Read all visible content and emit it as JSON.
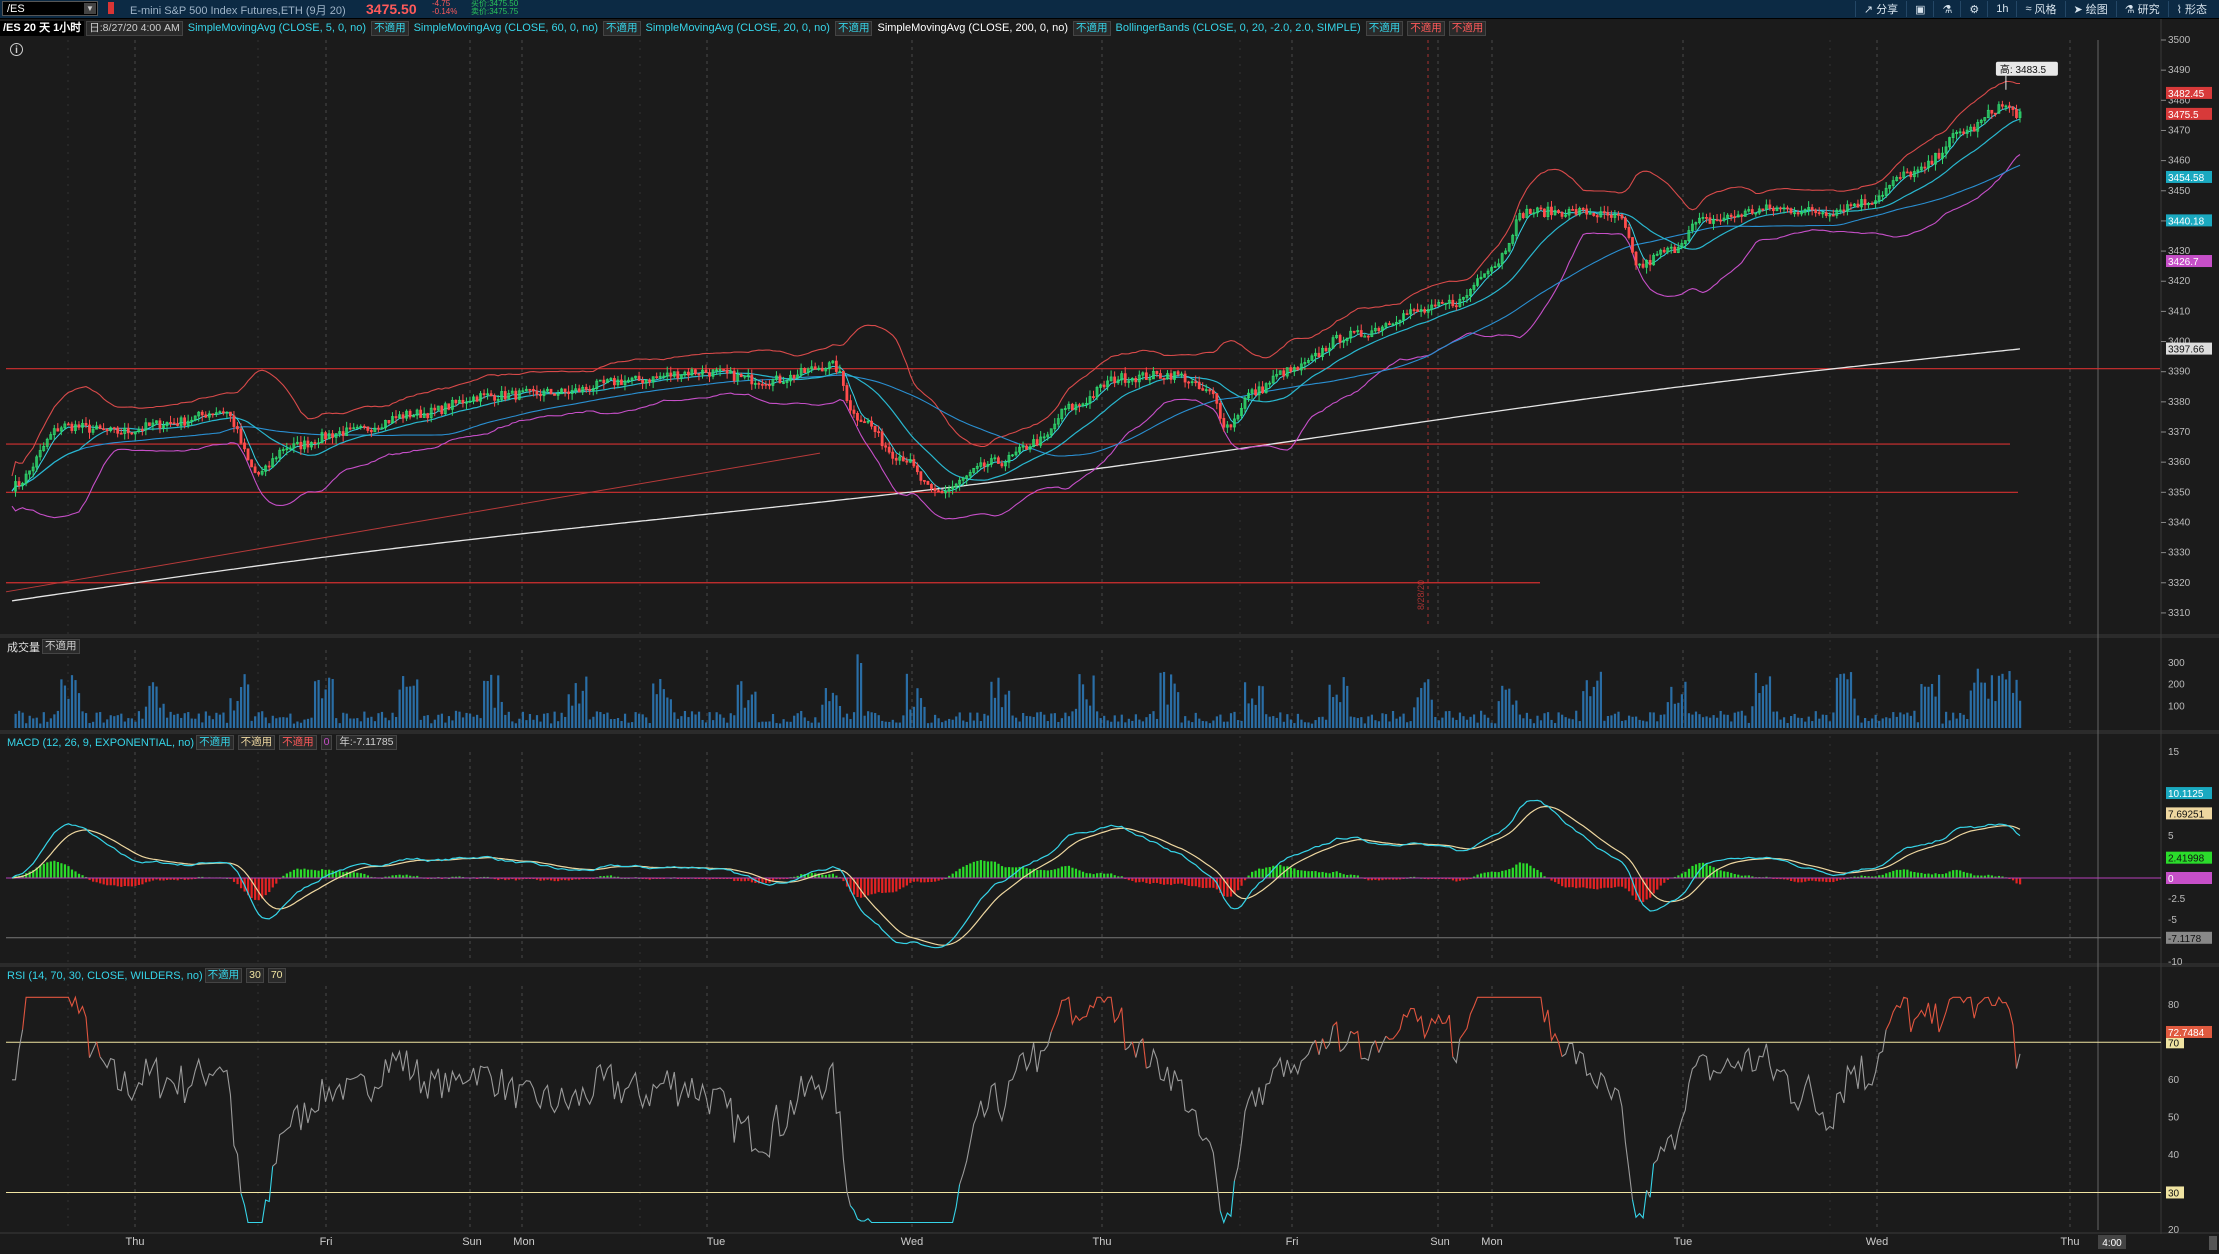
{
  "header": {
    "symbol": "/ES",
    "description": "E-mini S&P 500 Index Futures,ETH (9月 20)",
    "last_price": "3475.50",
    "change_lines": [
      "-4.75",
      "-0.14%"
    ],
    "bid_ask_lines": [
      "买价:3475.50",
      "卖价:3475.75"
    ],
    "toolbar": [
      {
        "label": "分享",
        "icon": "share-icon"
      },
      {
        "label": "",
        "icon": "layout-icon"
      },
      {
        "label": "",
        "icon": "flask-icon"
      },
      {
        "label": "",
        "icon": "gear-icon"
      },
      {
        "label": "1h",
        "icon": ""
      },
      {
        "label": "风格",
        "icon": "style-icon"
      },
      {
        "label": "绘图",
        "icon": "cursor-icon"
      },
      {
        "label": "研究",
        "icon": "flask-icon"
      },
      {
        "label": "形态",
        "icon": "pattern-icon"
      }
    ]
  },
  "study_bar": {
    "period": "/ES 20 天 1小时",
    "date": "日:8/27/20 4:00 AM",
    "studies": [
      {
        "text": "SimpleMovingAvg (CLOSE, 5, 0, no)",
        "color": "#36d4e8",
        "na": [
          "不適用"
        ]
      },
      {
        "text": "SimpleMovingAvg (CLOSE, 60, 0, no)",
        "color": "#36d4e8",
        "na": [
          "不適用"
        ]
      },
      {
        "text": "SimpleMovingAvg (CLOSE, 20, 0, no)",
        "color": "#36d4e8",
        "na": [
          "不適用"
        ]
      },
      {
        "text": "SimpleMovingAvg (CLOSE, 200, 0, no)",
        "color": "#ffffff",
        "na": [
          "不適用"
        ]
      },
      {
        "text": "BollingerBands (CLOSE, 0, 20, -2.0, 2.0, SIMPLE)",
        "color": "#36d4e8",
        "na": [
          "不適用",
          "不適用",
          "不適用"
        ]
      }
    ]
  },
  "volume_panel": {
    "label": "成交量",
    "na": "不適用"
  },
  "macd_panel": {
    "label": "MACD (12, 26, 9, EXPONENTIAL, no)",
    "na": [
      "不適用",
      "不適用",
      "不適用"
    ],
    "zero": "0",
    "extra": "年:-7.11785"
  },
  "rsi_panel": {
    "label": "RSI (14, 70, 30, CLOSE, WILDERS, no)",
    "na": "不適用",
    "levels": [
      "30",
      "70"
    ]
  },
  "price_tags": {
    "high_callout": "高: 3483.5",
    "last": "3475.5",
    "bb_upper": "3482.45",
    "sma5": "3454.58",
    "sma20": "3440.18",
    "bb_lower": "3426.7",
    "sma200": "3397.66"
  },
  "macd_tags": {
    "value": "10.1125",
    "avg": "7.69251",
    "diff": "2.41998",
    "zero": "0",
    "low_line": "-7.1178"
  },
  "rsi_tag": "72.7484",
  "rsi_level_tags": [
    "70",
    "30"
  ],
  "time_axis": {
    "days": [
      {
        "label": "Thu"
      },
      {
        "label": "Fri"
      },
      {
        "label": "Sun"
      },
      {
        "label": "Mon"
      },
      {
        "label": "Tue"
      },
      {
        "label": "Wed"
      },
      {
        "label": "Thu"
      },
      {
        "label": "Fri"
      },
      {
        "label": "Sun"
      },
      {
        "label": "Mon"
      },
      {
        "label": "Tue"
      },
      {
        "label": "Wed"
      },
      {
        "label": "Thu"
      }
    ],
    "current_time_badge": "4:00"
  },
  "vertical_marker_text": "8/28/20",
  "colors": {
    "background": "#1b1b1b",
    "up_candle": "#2fd86e",
    "down_candle": "#ff4d4d",
    "sma5": "#36d4e8",
    "sma20": "#29b7cf",
    "sma200": "#e6e6e6",
    "bb_upper": "#d84a4a",
    "bb_lower": "#c64fc8",
    "hline": "#d43030",
    "volume": "#2a6ea6",
    "macd_line": "#36d4e8",
    "macd_avg": "#eed7a0",
    "macd_pos": "#2bdc2b",
    "macd_neg": "#e52323",
    "rsi_line": "#9a9a9a",
    "rsi_ob": "#e0553f",
    "rsi_os": "#36d4e8",
    "level": "#f0e4a2"
  },
  "chart_data": [
    {
      "type": "candlestick",
      "title": "/ES 20 天 1小时",
      "x_tick_labels": [
        "Thu",
        "Fri",
        "Sun",
        "Mon",
        "Tue",
        "Wed",
        "Thu",
        "Fri",
        "Sun",
        "Mon",
        "Tue",
        "Wed",
        "Thu"
      ],
      "ylim": [
        3305,
        3500
      ],
      "y_ticks": [
        3310,
        3320,
        3330,
        3340,
        3350,
        3360,
        3370,
        3380,
        3390,
        3400,
        3410,
        3420,
        3430,
        3440,
        3450,
        3460,
        3470,
        3480,
        3490,
        3500
      ],
      "horizontal_levels": [
        3391,
        3366,
        3350,
        3320
      ],
      "last_values": {
        "close": 3475.5,
        "high": 3483.5,
        "bb_upper": 3482.45,
        "sma5": 3454.58,
        "sma20": 3440.18,
        "bb_lower": 3426.7,
        "sma200": 3397.66
      },
      "series": []
    },
    {
      "type": "bar",
      "title": "成交量",
      "ylim": [
        0,
        360
      ],
      "y_ticks": [
        100,
        200,
        300
      ],
      "values": []
    },
    {
      "type": "line",
      "title": "MACD (12, 26, 9, EXPONENTIAL, no)",
      "ylim": [
        -10,
        15
      ],
      "y_ticks": [
        15,
        10,
        5,
        0,
        -2.5,
        -5,
        -7.5,
        -10
      ],
      "last_values": {
        "value": 10.1125,
        "avg": 7.69251,
        "diff": 2.41998,
        "low_line": -7.1178
      },
      "series": []
    },
    {
      "type": "line",
      "title": "RSI (14, 70, 30, CLOSE, WILDERS, no)",
      "ylim": [
        20,
        85
      ],
      "y_ticks": [
        20,
        30,
        40,
        50,
        60,
        70,
        80
      ],
      "levels": [
        30,
        70
      ],
      "last_value": 72.7484,
      "series": []
    }
  ]
}
